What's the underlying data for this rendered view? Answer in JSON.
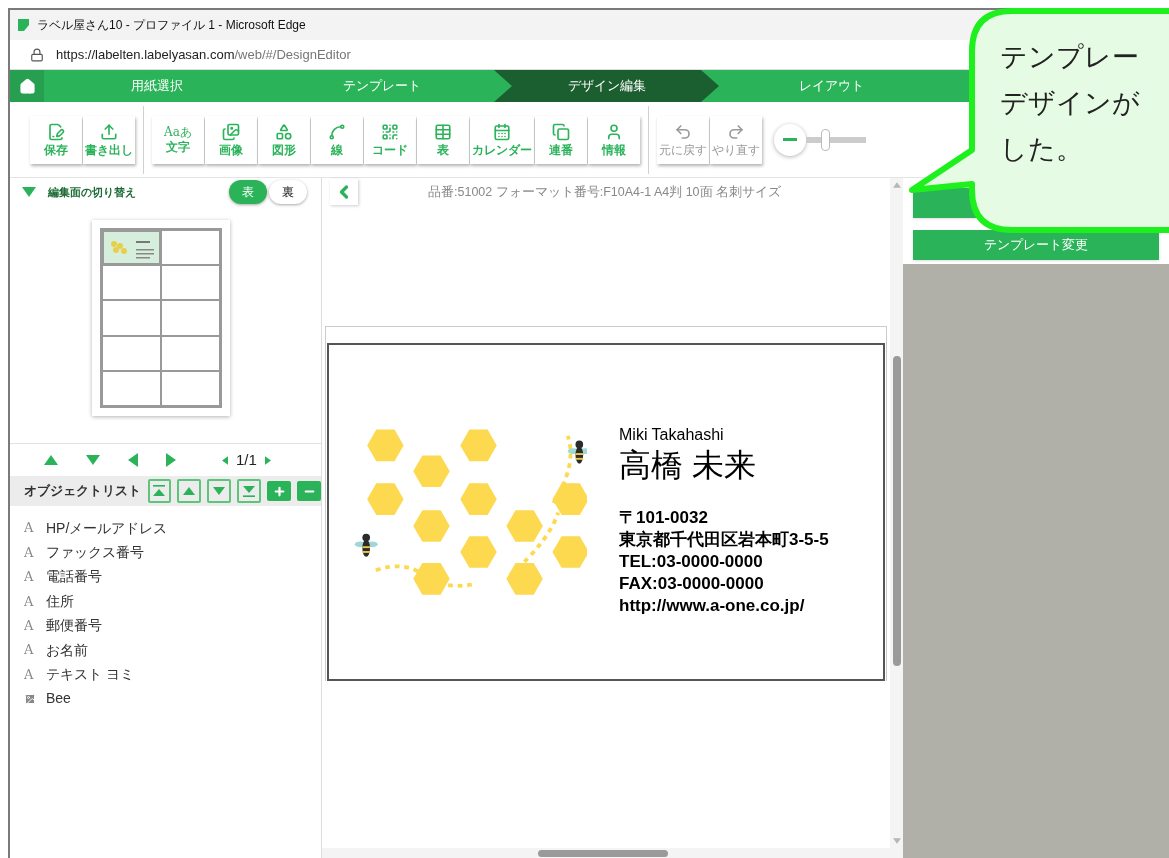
{
  "window": {
    "title": "ラベル屋さん10 - プロファイル 1 - Microsoft Edge",
    "url_host": "https://labelten.labelyasan.com",
    "url_path": "/web/#/DesignEditor"
  },
  "steps": [
    {
      "label": "用紙選択",
      "selected": false
    },
    {
      "label": "テンプレート",
      "selected": false
    },
    {
      "label": "デザイン編集",
      "selected": true
    },
    {
      "label": "レイアウト",
      "selected": false
    }
  ],
  "toolbar": {
    "groups": [
      [
        {
          "label": "保存",
          "kind": "save",
          "disabled": false
        },
        {
          "label": "書き出し",
          "kind": "export",
          "disabled": false
        }
      ],
      [
        {
          "label": "文字",
          "kind": "text",
          "glyph": "Aaあ",
          "disabled": false
        },
        {
          "label": "画像",
          "kind": "image",
          "disabled": false
        },
        {
          "label": "図形",
          "kind": "shape",
          "disabled": false
        },
        {
          "label": "線",
          "kind": "line",
          "disabled": false
        },
        {
          "label": "コード",
          "kind": "code",
          "disabled": false
        },
        {
          "label": "表",
          "kind": "table",
          "disabled": false
        },
        {
          "label": "カレンダー",
          "kind": "calendar",
          "disabled": false
        },
        {
          "label": "連番",
          "kind": "serial",
          "disabled": false
        },
        {
          "label": "情報",
          "kind": "info",
          "disabled": false
        }
      ],
      [
        {
          "label": "元に戻す",
          "kind": "undo",
          "disabled": true
        },
        {
          "label": "やり直す",
          "kind": "redo",
          "disabled": true
        }
      ]
    ],
    "zoom": {
      "level": 0.3
    }
  },
  "left_panel": {
    "title": "編集面の切り替え",
    "expanded": true,
    "sides": [
      {
        "label": "表",
        "selected": true
      },
      {
        "label": "裏",
        "selected": false
      }
    ],
    "page": "1/1",
    "object_list": {
      "title": "オブジェクトリスト",
      "items": [
        {
          "label": "HP/メールアドレス",
          "kind": "text",
          "glyph": "A"
        },
        {
          "label": "ファックス番号",
          "kind": "text",
          "glyph": "A"
        },
        {
          "label": "電話番号",
          "kind": "text",
          "glyph": "A"
        },
        {
          "label": "住所",
          "kind": "text",
          "glyph": "A"
        },
        {
          "label": "郵便番号",
          "kind": "text",
          "glyph": "A"
        },
        {
          "label": "お名前",
          "kind": "text",
          "glyph": "A"
        },
        {
          "label": "テキスト ヨミ",
          "kind": "text",
          "glyph": "A"
        },
        {
          "label": "Bee",
          "kind": "image"
        }
      ]
    }
  },
  "canvas": {
    "info": "品番:51002 フォーマット番号:F10A4-1 A4判 10面 名刺サイズ",
    "card": {
      "romaji": "Miki Takahashi",
      "name": "高橋 未来",
      "lines": [
        "〒101-0032",
        "東京都千代田区岩本町3-5-5",
        "TEL:03-0000-0000",
        "FAX:03-0000-0000",
        "http://www.a-one.co.jp/"
      ]
    }
  },
  "right_panel": {
    "buttons": [
      "テンプレート変更"
    ]
  },
  "callout": {
    "lines": [
      "テンプレー",
      "デザインが",
      "した。"
    ]
  }
}
